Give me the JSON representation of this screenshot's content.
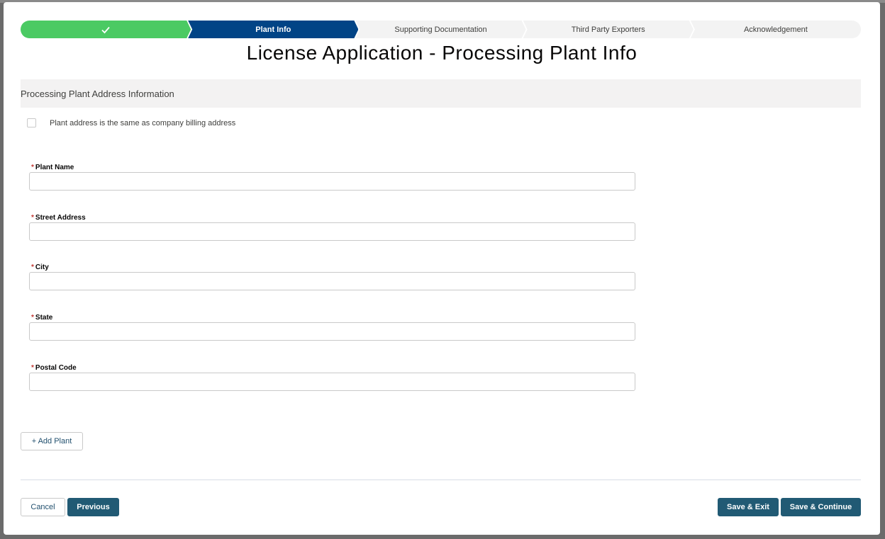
{
  "title": "License Application - Processing Plant Info",
  "path": {
    "steps": [
      {
        "label": "",
        "state": "complete",
        "icon": "check-icon"
      },
      {
        "label": "Plant Info",
        "state": "current"
      },
      {
        "label": "Supporting Documentation",
        "state": "incomplete"
      },
      {
        "label": "Third Party Exporters",
        "state": "incomplete"
      },
      {
        "label": "Acknowledgement",
        "state": "incomplete"
      }
    ]
  },
  "section": {
    "title": "Processing Plant Address Information"
  },
  "same_address": {
    "label": "Plant address is the same as company billing address",
    "checked": false
  },
  "fields": [
    {
      "label": "Plant Name",
      "required": true,
      "value": ""
    },
    {
      "label": "Street Address",
      "required": true,
      "value": ""
    },
    {
      "label": "City",
      "required": true,
      "value": ""
    },
    {
      "label": "State",
      "required": true,
      "value": ""
    },
    {
      "label": "Postal Code",
      "required": true,
      "value": ""
    }
  ],
  "required_marker": "*",
  "add_plant_label": "+ Add Plant",
  "footer": {
    "cancel": "Cancel",
    "previous": "Previous",
    "save_exit": "Save & Exit",
    "save_continue": "Save & Continue"
  },
  "colors": {
    "complete": "#4bca63",
    "current": "#014486",
    "brand_button": "#215a74",
    "required": "#c23934"
  }
}
